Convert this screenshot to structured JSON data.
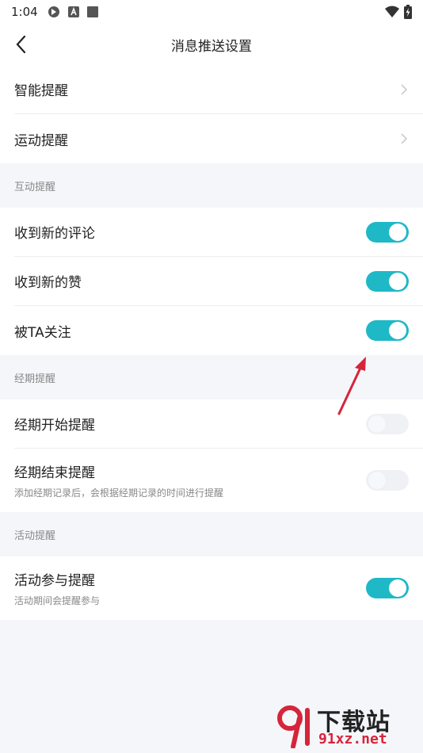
{
  "status_bar": {
    "time": "1:04"
  },
  "header": {
    "title": "消息推送设置"
  },
  "top_items": [
    {
      "label": "智能提醒"
    },
    {
      "label": "运动提醒"
    }
  ],
  "interaction": {
    "header": "互动提醒",
    "items": [
      {
        "label": "收到新的评论",
        "on": true
      },
      {
        "label": "收到新的赞",
        "on": true
      },
      {
        "label": "被TA关注",
        "on": true
      }
    ]
  },
  "period": {
    "header": "经期提醒",
    "items": [
      {
        "label": "经期开始提醒",
        "sub": "",
        "on": false
      },
      {
        "label": "经期结束提醒",
        "sub": "添加经期记录后，会根据经期记录的时间进行提醒",
        "on": false
      }
    ]
  },
  "activity": {
    "header": "活动提醒",
    "items": [
      {
        "label": "活动参与提醒",
        "sub": "活动期间会提醒参与",
        "on": true
      }
    ]
  },
  "watermark": {
    "brand": "下载站",
    "url": "91xz.net"
  },
  "colors": {
    "toggle_on": "#1fb8c6",
    "arrow": "#d6243a"
  }
}
